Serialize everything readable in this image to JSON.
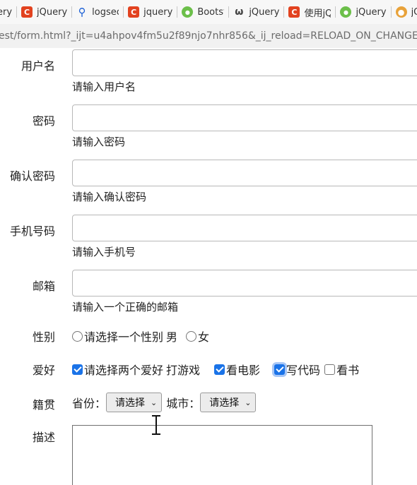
{
  "bookmarks": [
    {
      "label": "ery",
      "icon": "none"
    },
    {
      "label": "jQuery",
      "icon": "csdn-c-icon"
    },
    {
      "label": "logsec",
      "icon": "search-icon"
    },
    {
      "label": "jquery",
      "icon": "csdn-c-icon"
    },
    {
      "label": "Bootst",
      "icon": "runoob-icon"
    },
    {
      "label": "jQuery",
      "icon": "omega-icon"
    },
    {
      "label": "使用jQ",
      "icon": "csdn-c-icon"
    },
    {
      "label": "jQuery",
      "icon": "runoob-icon"
    },
    {
      "label": "jQ",
      "icon": "lion-icon"
    }
  ],
  "address": {
    "url": "est/form.html?_ijt=u4ahpov4fm5u2f89njo7nhr856&_ij_reload=RELOAD_ON_CHANGE"
  },
  "form": {
    "username": {
      "label": "用户名",
      "value": "",
      "hint": "请输入用户名"
    },
    "password": {
      "label": "密码",
      "value": "",
      "hint": "请输入密码"
    },
    "confirm_password": {
      "label": "确认密码",
      "value": "",
      "hint": "请输入确认密码"
    },
    "phone": {
      "label": "手机号码",
      "value": "",
      "hint": "请输入手机号"
    },
    "email": {
      "label": "邮箱",
      "value": "",
      "hint": "请输入一个正确的邮箱"
    },
    "gender": {
      "label": "性别",
      "options": [
        {
          "label": "请选择一个性别",
          "checked": false
        },
        {
          "label": "男",
          "checked": false
        },
        {
          "label": "女",
          "checked": false
        }
      ]
    },
    "hobby": {
      "label": "爱好",
      "options": [
        {
          "label": "请选择两个爱好",
          "checked": true
        },
        {
          "label": "打游戏",
          "checked": true
        },
        {
          "label": "看电影",
          "checked": true
        },
        {
          "label": "写代码",
          "checked": false
        },
        {
          "label": "看书",
          "checked": false
        }
      ]
    },
    "hometown": {
      "label": "籍贯",
      "province_label": "省份：",
      "province_value": "请选择",
      "city_label": "城市：",
      "city_value": "请选择"
    },
    "description": {
      "label": "描述",
      "value": ""
    }
  },
  "colors": {
    "checkbox_checked": "#1a73e8",
    "bookmark_red": "#e2421f",
    "bookmark_green": "#6cbf4a"
  }
}
